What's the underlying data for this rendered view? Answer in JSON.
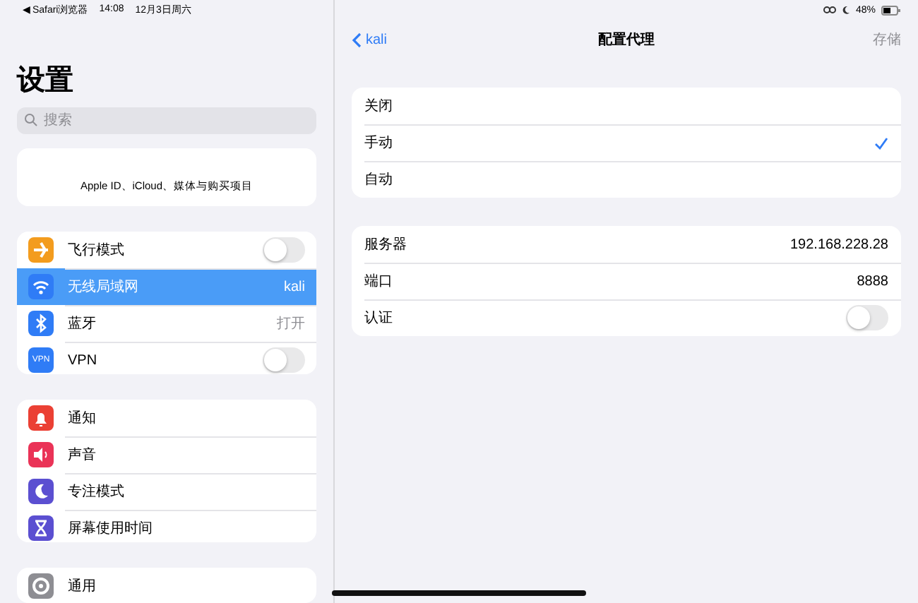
{
  "status_bar": {
    "back_app": "◀ Safari浏览器",
    "time": "14:08",
    "date": "12月3日周六",
    "battery_percent": "48%"
  },
  "sidebar": {
    "title": "设置",
    "search": {
      "placeholder": "搜索"
    },
    "apple_id": "Apple ID、iCloud、媒体与购买项目",
    "groups": [
      [
        {
          "label": "飞行模式",
          "kind": "toggle",
          "on": false,
          "color": "#f39c1e",
          "selected": false
        },
        {
          "label": "无线局域网",
          "kind": "value",
          "value": "kali",
          "color": "#2f7cf6",
          "selected": true
        },
        {
          "label": "蓝牙",
          "kind": "value",
          "value": "打开",
          "color": "#2f7cf6",
          "selected": false
        },
        {
          "label": "VPN",
          "kind": "toggle",
          "on": false,
          "color": "#2f7cf6",
          "badge_text": "VPN",
          "selected": false
        }
      ],
      [
        {
          "label": "通知",
          "kind": "plain",
          "color": "#eb4034",
          "selected": false
        },
        {
          "label": "声音",
          "kind": "plain",
          "color": "#ea3357",
          "selected": false
        },
        {
          "label": "专注模式",
          "kind": "plain",
          "color": "#5b4fd1",
          "selected": false
        },
        {
          "label": "屏幕使用时间",
          "kind": "plain",
          "color": "#5b4fd1",
          "selected": false
        }
      ],
      [
        {
          "label": "通用",
          "kind": "plain",
          "color": "#8e8e93",
          "selected": false
        }
      ]
    ]
  },
  "detail": {
    "back": "kali",
    "title": "配置代理",
    "save": "存储",
    "modes": [
      {
        "label": "关闭",
        "selected": false
      },
      {
        "label": "手动",
        "selected": true
      },
      {
        "label": "自动",
        "selected": false
      }
    ],
    "fields": [
      {
        "label": "服务器",
        "kind": "value",
        "value": "192.168.228.28"
      },
      {
        "label": "端口",
        "kind": "value",
        "value": "8888"
      },
      {
        "label": "认证",
        "kind": "toggle",
        "on": false
      }
    ]
  }
}
